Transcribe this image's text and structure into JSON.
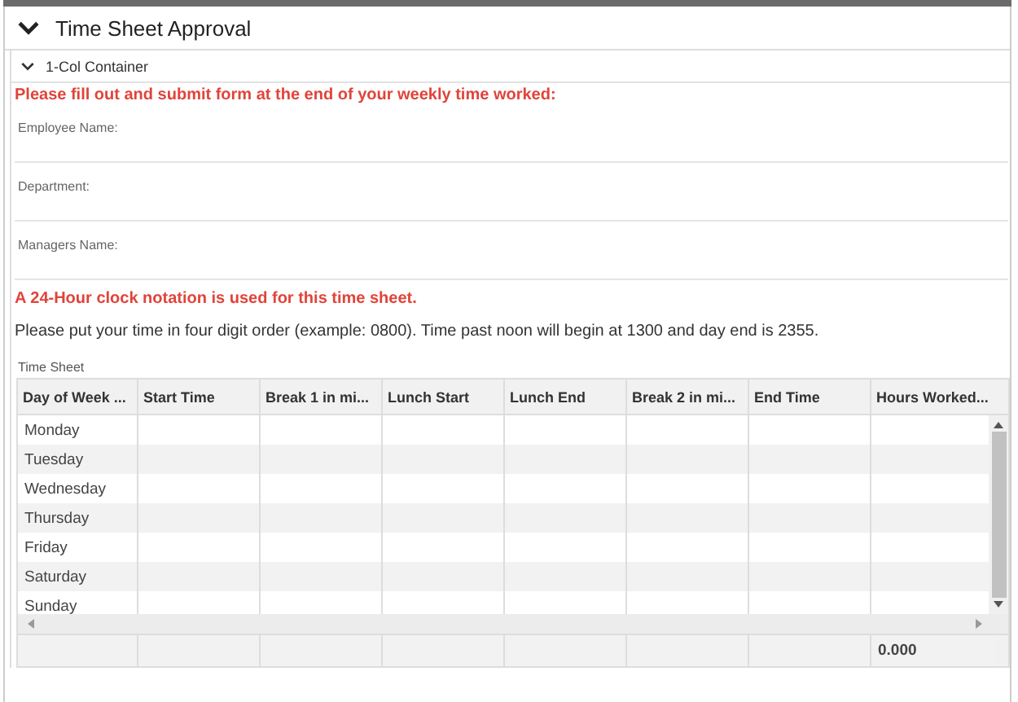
{
  "panel": {
    "title": "Time Sheet Approval",
    "expanded": true
  },
  "container": {
    "title": "1-Col Container",
    "expanded": true
  },
  "intro": "Please fill out and submit form at the end of your weekly time worked:",
  "fields": [
    {
      "label": "Employee Name:"
    },
    {
      "label": "Department:"
    },
    {
      "label": "Managers Name:"
    }
  ],
  "notice": "A 24-Hour clock notation is used for this time sheet.",
  "instructions": "Please put your time in four digit order (example: 0800). Time past noon will begin at 1300 and day end is 2355.",
  "table": {
    "label": "Time Sheet",
    "columns": [
      "Day of Week ...",
      "Start Time",
      "Break 1 in mi...",
      "Lunch Start",
      "Lunch End",
      "Break 2 in mi...",
      "End Time",
      "Hours Worked..."
    ],
    "rows": [
      [
        "Monday"
      ],
      [
        "Tuesday"
      ],
      [
        "Wednesday"
      ],
      [
        "Thursday"
      ],
      [
        "Friday"
      ],
      [
        "Saturday"
      ],
      [
        "Sunday"
      ]
    ],
    "total": "0.000"
  }
}
